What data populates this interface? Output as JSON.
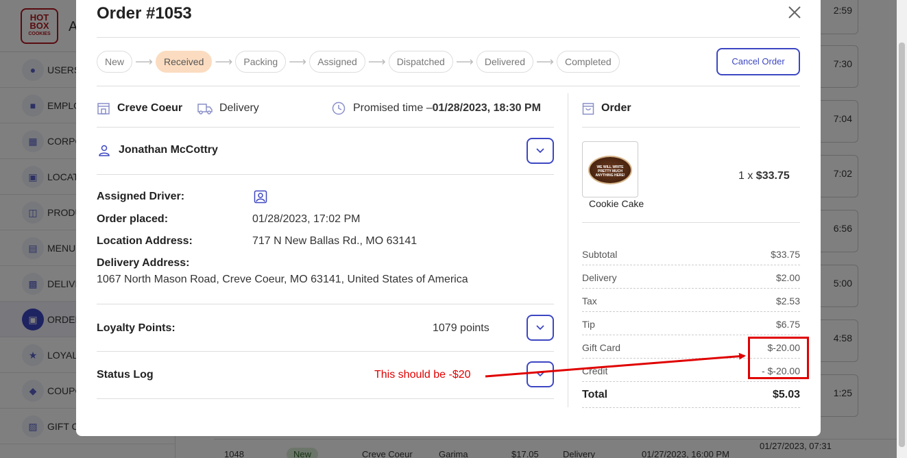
{
  "background": {
    "logo_top": "HOT",
    "logo_mid": "BOX",
    "logo_bottom": "COOKIES",
    "app_title": "A",
    "nav": [
      "USERS",
      "EMPLO",
      "CORPO",
      "LOCAT",
      "PRODU",
      "MENU",
      "DELIVE",
      "ORDER",
      "LOYAL",
      "COUPO",
      "GIFT C"
    ],
    "card_times": [
      "2:59",
      "7:30",
      "7:04",
      "7:02",
      "6:56",
      "5:00",
      "4:58",
      "1:25"
    ],
    "last_row": {
      "id": "1048",
      "status": "New",
      "location": "Creve Coeur",
      "name": "Garima",
      "amount": "$17.05",
      "type": "Delivery",
      "promised": "01/27/2023, 16:00 PM",
      "placed": "01/27/2023, 07:31"
    }
  },
  "modal": {
    "title": "Order #1053",
    "steps": [
      "New",
      "Received",
      "Packing",
      "Assigned",
      "Dispatched",
      "Delivered",
      "Completed"
    ],
    "current_step": "Received",
    "cancel_label": "Cancel Order",
    "location": "Creve Coeur",
    "delivery_type": "Delivery",
    "promised_label": "Promised time –",
    "promised_value": "01/28/2023, 18:30 PM",
    "customer": "Jonathan McCottry",
    "details": {
      "assigned_driver_label": "Assigned Driver:",
      "order_placed_label": "Order placed:",
      "order_placed_value": "01/28/2023, 17:02 PM",
      "location_address_label": "Location Address:",
      "location_address_value": "717 N New Ballas Rd., MO 63141",
      "delivery_address_label": "Delivery Address:",
      "delivery_address_value": "1067 North Mason Road, Creve Coeur, MO 63141, United States of America"
    },
    "loyalty_label": "Loyalty Points:",
    "loyalty_value": "1079 points",
    "status_log_label": "Status Log",
    "order_header": "Order",
    "product": {
      "image_text": "WE WILL WRITE PRETTY MUCH ANYTHING HERE!",
      "name": "Cookie Cake",
      "qty_prefix": "1 x",
      "price": "$33.75"
    },
    "summary": [
      {
        "label": "Subtotal",
        "value": "$33.75"
      },
      {
        "label": "Delivery",
        "value": "$2.00"
      },
      {
        "label": "Tax",
        "value": "$2.53"
      },
      {
        "label": "Tip",
        "value": "$6.75"
      },
      {
        "label": "Gift Card",
        "value": "$-20.00"
      },
      {
        "label": "Credit",
        "value": "- $-20.00"
      }
    ],
    "total_label": "Total",
    "total_value": "$5.03"
  },
  "annotation": {
    "text": "This should be -$20",
    "color": "#e00000"
  },
  "colors": {
    "accent": "#3c46c2",
    "step_current": "#fbdcc0",
    "brand": "#b3181f"
  }
}
